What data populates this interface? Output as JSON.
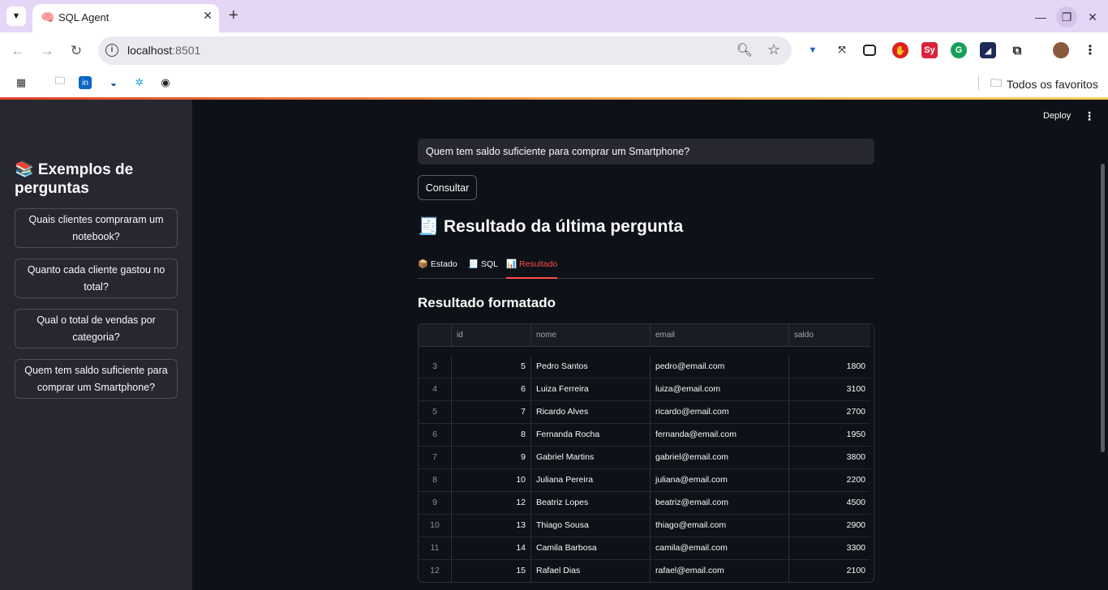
{
  "browser": {
    "tab_title": "SQL Agent",
    "tab_favicon": "🧠",
    "url_host": "localhost",
    "url_port": ":8501",
    "bookmarks_folder": "Todos os favoritos"
  },
  "app": {
    "deploy_label": "Deploy",
    "sidebar": {
      "title": "📚 Exemplos de perguntas",
      "examples": [
        "Quais clientes compraram um notebook?",
        "Quanto cada cliente gastou no total?",
        "Qual o total de vendas por categoria?",
        "Quem tem saldo suficiente para comprar um Smartphone?"
      ]
    },
    "query_value": "Quem tem saldo suficiente para comprar um Smartphone?",
    "consult_label": "Consultar",
    "result_title": "🧾 Resultado da última pergunta",
    "tabs": [
      "📦 Estado",
      "🧾 SQL",
      "📊 Resultado"
    ],
    "active_tab": "📊 Resultado",
    "section_title": "Resultado formatado",
    "table": {
      "columns": [
        "id",
        "nome",
        "email",
        "saldo"
      ],
      "rows": [
        {
          "idx": "3",
          "id": "5",
          "nome": "Pedro Santos",
          "email": "pedro@email.com",
          "saldo": "1800"
        },
        {
          "idx": "4",
          "id": "6",
          "nome": "Luiza Ferreira",
          "email": "luiza@email.com",
          "saldo": "3100"
        },
        {
          "idx": "5",
          "id": "7",
          "nome": "Ricardo Alves",
          "email": "ricardo@email.com",
          "saldo": "2700"
        },
        {
          "idx": "6",
          "id": "8",
          "nome": "Fernanda Rocha",
          "email": "fernanda@email.com",
          "saldo": "1950"
        },
        {
          "idx": "7",
          "id": "9",
          "nome": "Gabriel Martins",
          "email": "gabriel@email.com",
          "saldo": "3800"
        },
        {
          "idx": "8",
          "id": "10",
          "nome": "Juliana Pereira",
          "email": "juliana@email.com",
          "saldo": "2200"
        },
        {
          "idx": "9",
          "id": "12",
          "nome": "Beatriz Lopes",
          "email": "beatriz@email.com",
          "saldo": "4500"
        },
        {
          "idx": "10",
          "id": "13",
          "nome": "Thiago Sousa",
          "email": "thiago@email.com",
          "saldo": "2900"
        },
        {
          "idx": "11",
          "id": "14",
          "nome": "Camila Barbosa",
          "email": "camila@email.com",
          "saldo": "3300"
        },
        {
          "idx": "12",
          "id": "15",
          "nome": "Rafael Dias",
          "email": "rafael@email.com",
          "saldo": "2100"
        }
      ]
    }
  },
  "colors": {
    "accent": "#ff4b4b",
    "sidebar_bg": "#262730",
    "main_bg": "#0e1117"
  }
}
